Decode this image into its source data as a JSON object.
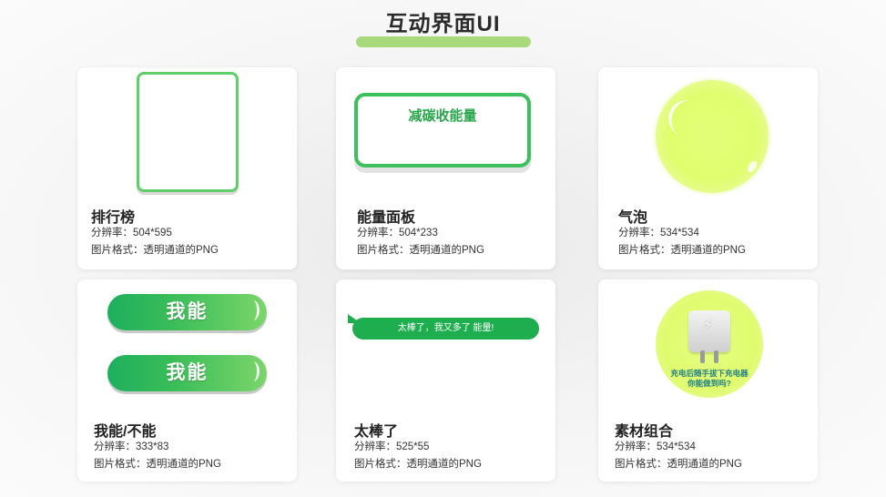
{
  "header": {
    "title": "互动界面UI"
  },
  "labels": {
    "resolution": "分辨率：",
    "format": "图片格式："
  },
  "cards": [
    {
      "name": "排行榜",
      "resolution": "504*595",
      "format": "透明通道的PNG"
    },
    {
      "name": "能量面板",
      "resolution": "504*233",
      "format": "透明通道的PNG",
      "preview_text": "减碳收能量"
    },
    {
      "name": "气泡",
      "resolution": "534*534",
      "format": "透明通道的PNG"
    },
    {
      "name": "我能/不能",
      "resolution": "333*83",
      "format": "透明通道的PNG",
      "preview_buttons": [
        "我能",
        "我能"
      ]
    },
    {
      "name": "太棒了",
      "resolution": "525*55",
      "format": "透明通道的PNG",
      "preview_text": "太棒了，我又多了      能量!"
    },
    {
      "name": "素材组合",
      "resolution": "534*534",
      "format": "透明通道的PNG",
      "preview_text_line1": "充电后随手拔下充电器",
      "preview_text_line2": "你能做到吗?"
    }
  ],
  "colors": {
    "accent_green": "#3cc05e",
    "title_underline": "#a8d97a",
    "bubble_yellow": "#e0fd6e"
  }
}
